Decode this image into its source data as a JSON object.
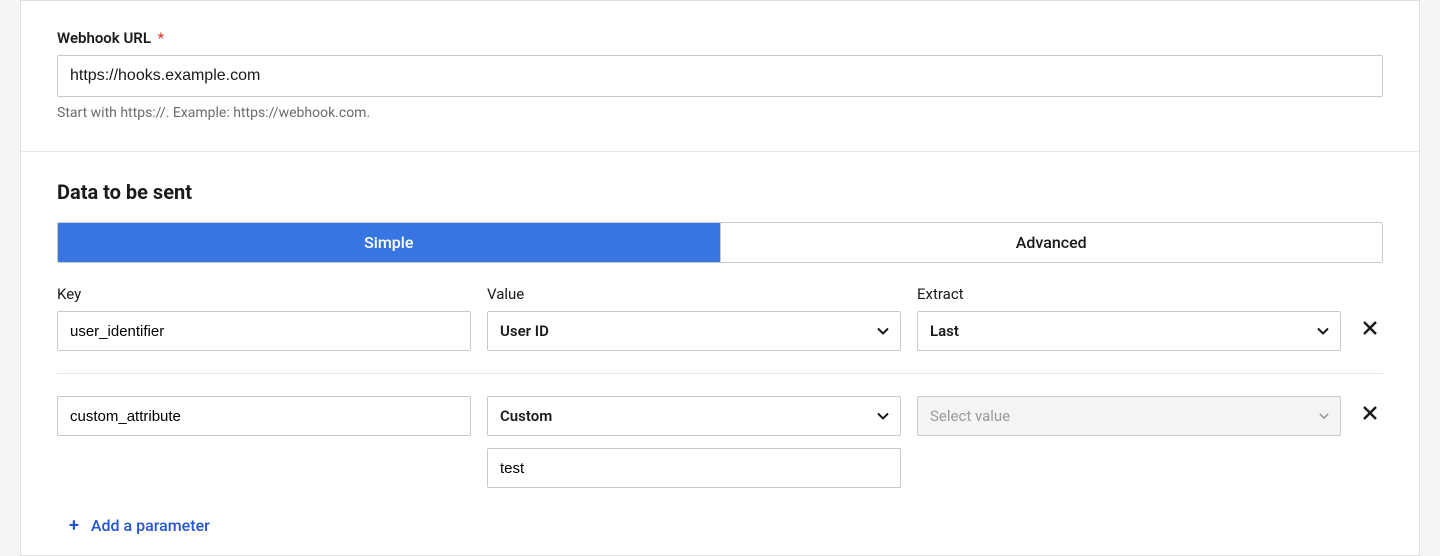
{
  "webhook": {
    "label": "Webhook URL",
    "required_mark": "*",
    "value": "https://hooks.example.com",
    "help": "Start with https://. Example: https://webhook.com."
  },
  "data_section": {
    "title": "Data to be sent",
    "tabs": {
      "simple": "Simple",
      "advanced": "Advanced"
    },
    "columns": {
      "key": "Key",
      "value": "Value",
      "extract": "Extract"
    },
    "rows": [
      {
        "key": "user_identifier",
        "value_selected": "User ID",
        "extract_selected": "Last",
        "extract_disabled": false,
        "custom_sub": null
      },
      {
        "key": "custom_attribute",
        "value_selected": "Custom",
        "extract_selected": "Select value",
        "extract_disabled": true,
        "custom_sub": "test"
      }
    ],
    "add_label": "Add a parameter"
  }
}
